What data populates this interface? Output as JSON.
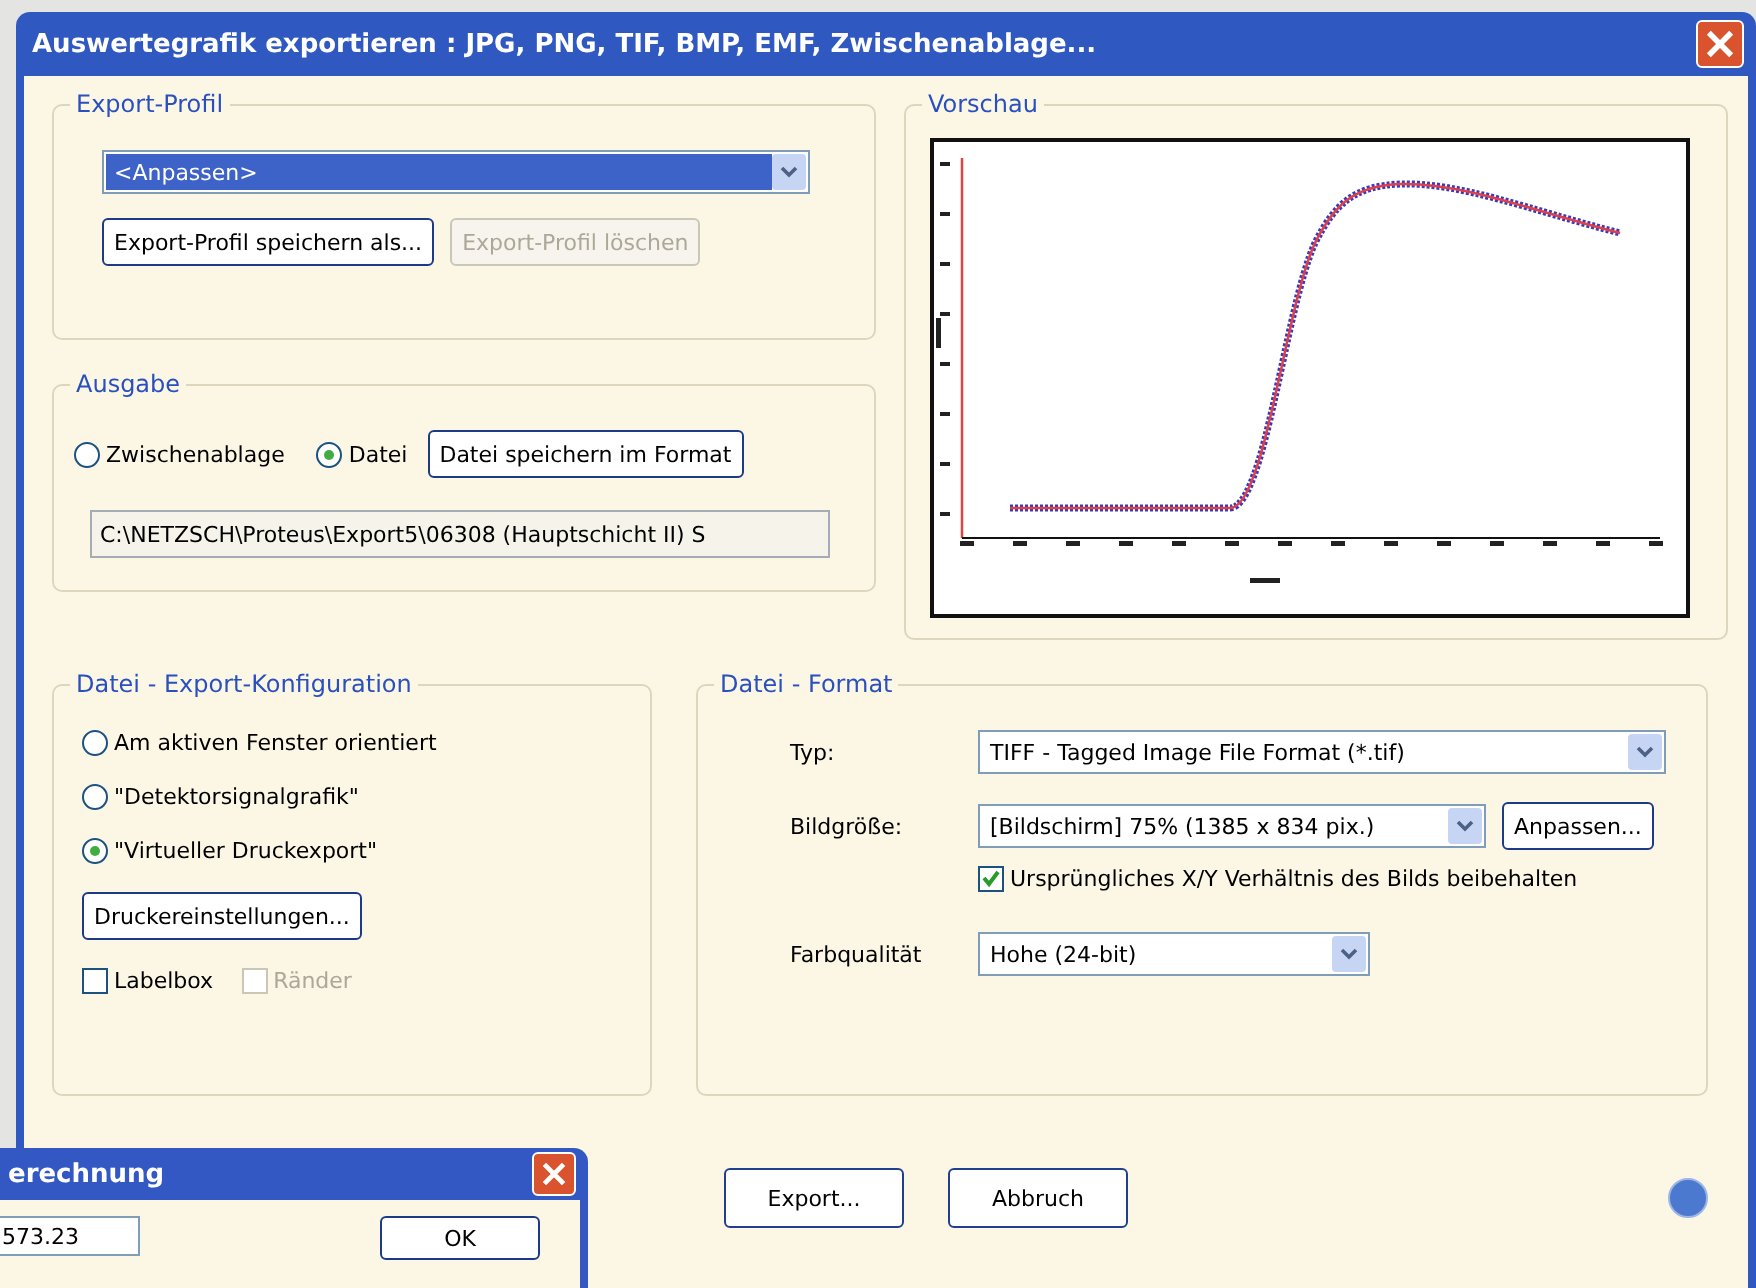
{
  "window": {
    "title": "Auswertegrafik exportieren : JPG, PNG, TIF, BMP, EMF, Zwischenablage..."
  },
  "export_profile": {
    "label": "Export-Profil",
    "select": "<Anpassen>",
    "buttons": [
      {
        "label": "Export-Profil speichern als...",
        "disabled": false
      },
      {
        "label": "Export-Profil löschen",
        "disabled": true
      }
    ]
  },
  "output": {
    "label": "Ausgabe",
    "options": [
      {
        "label": "Zwischenablage",
        "selected": false
      },
      {
        "label": "Datei",
        "selected": true
      }
    ],
    "button": "Datei speichern im Format",
    "path": "C:\\NETZSCH\\Proteus\\Export5\\06308 (Hauptschicht II) S"
  },
  "preview": {
    "label": "Vorschau"
  },
  "config": {
    "label": "Datei - Export-Konfiguration",
    "options": [
      {
        "label": "Am aktiven Fenster orientiert",
        "selected": false
      },
      {
        "label": "\"Detektorsignalgrafik\"",
        "selected": false
      },
      {
        "label": "\"Virtueller Druckexport\"",
        "selected": true
      }
    ],
    "button": "Druckereinstellungen...",
    "checkboxes": [
      {
        "label": "Labelbox",
        "checked": false,
        "disabled": false
      },
      {
        "label": "Ränder",
        "checked": false,
        "disabled": true
      }
    ]
  },
  "format": {
    "label": "Datei - Format",
    "type": {
      "label": "Typ:",
      "value": "TIFF - Tagged Image File Format (*.tif)"
    },
    "size": {
      "label": "Bildgröße:",
      "value": "[Bildschirm]  75%  (1385 x 834 pix.)",
      "button": "Anpassen..."
    },
    "keep_ratio": {
      "label": "Ursprüngliches X/Y Verhältnis des Bilds beibehalten",
      "checked": true
    },
    "quality": {
      "label": "Farbqualität",
      "value": "Hohe (24-bit)"
    }
  },
  "footer_buttons": [
    "Export...",
    "Abbruch"
  ],
  "sub_dialog": {
    "title": "erechnung",
    "value": "573.23",
    "button": "OK"
  }
}
